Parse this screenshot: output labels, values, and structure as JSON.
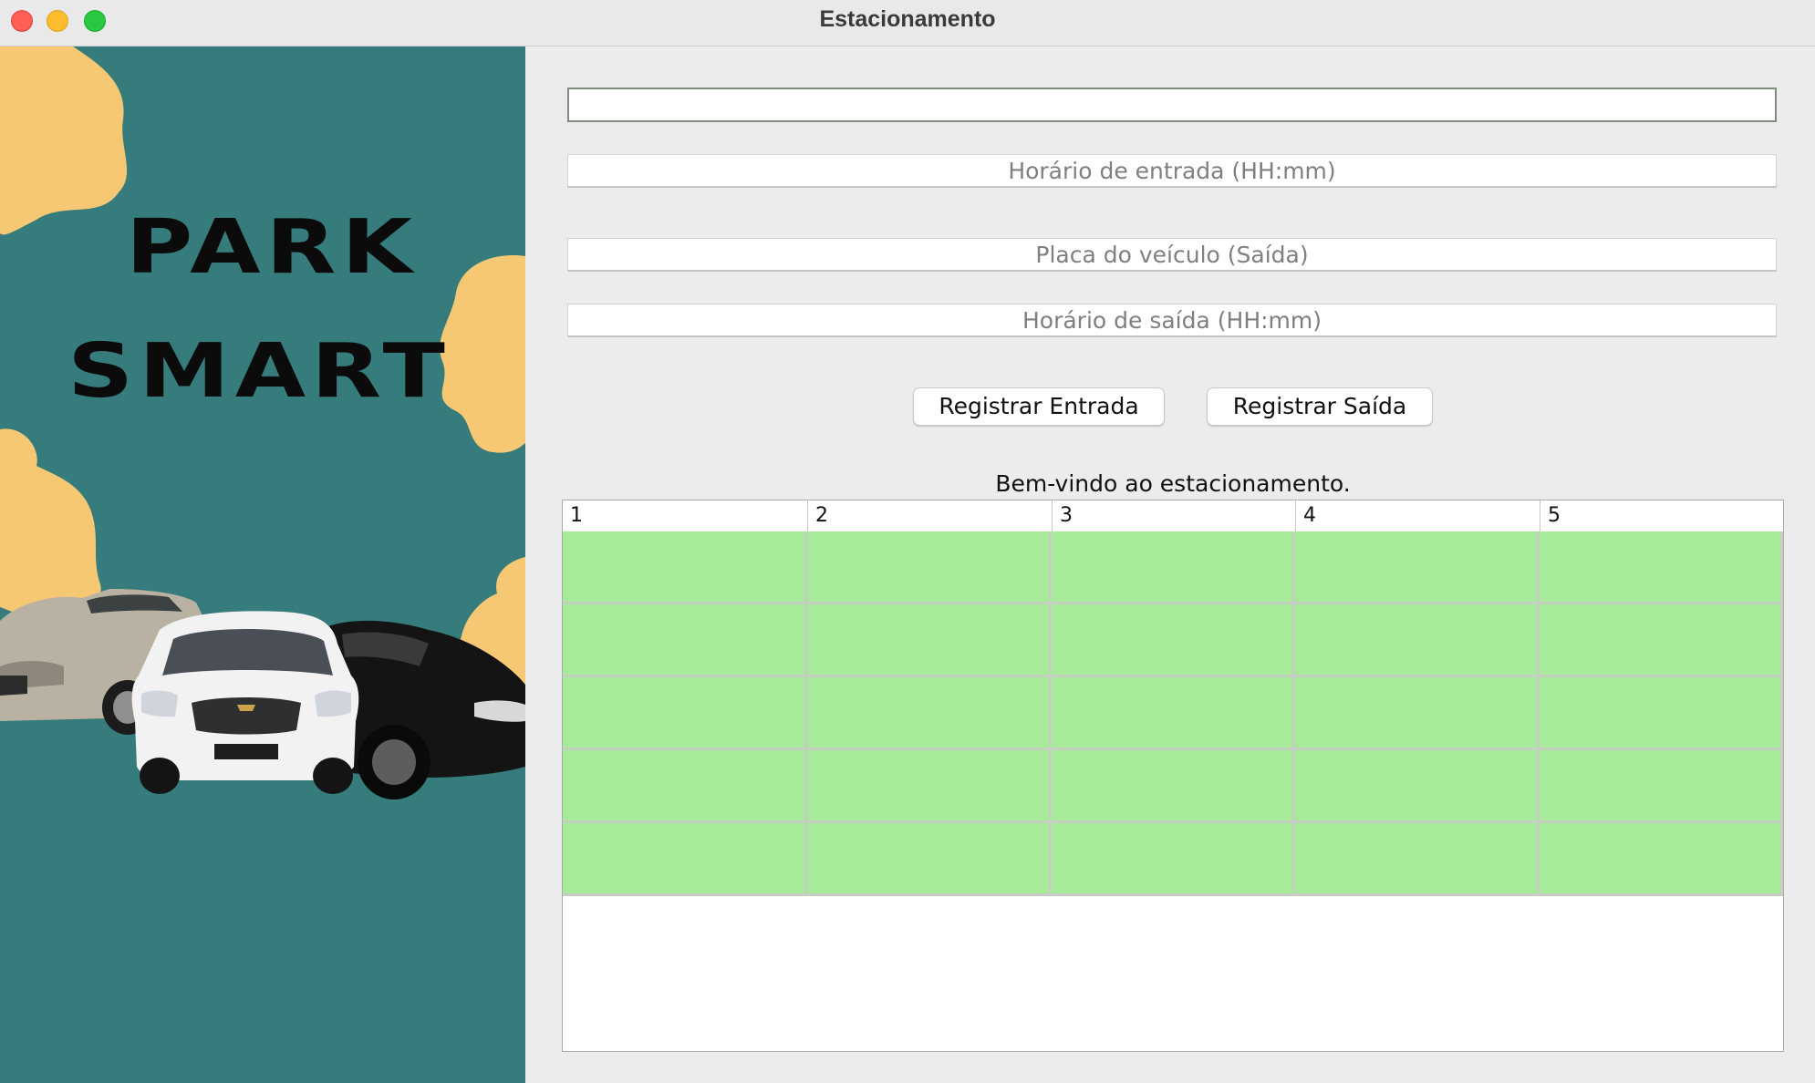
{
  "window": {
    "title": "Estacionamento"
  },
  "brand": {
    "line1": "PARK",
    "line2": "SMART",
    "panel_color": "#367c7c",
    "blob_color": "#f7c873"
  },
  "form": {
    "plate_entry": {
      "value": "",
      "placeholder": ""
    },
    "entry_time": {
      "value": "",
      "placeholder": "Horário de entrada (HH:mm)"
    },
    "plate_exit": {
      "value": "",
      "placeholder": "Placa do veículo (Saída)"
    },
    "exit_time": {
      "value": "",
      "placeholder": "Horário de saída (HH:mm)"
    }
  },
  "buttons": {
    "register_entry": "Registrar Entrada",
    "register_exit": "Registrar Saída"
  },
  "status_message": "Bem-vindo ao estacionamento.",
  "table": {
    "columns": [
      "1",
      "2",
      "3",
      "4",
      "5"
    ],
    "rows": [
      [
        "",
        "",
        "",
        "",
        ""
      ],
      [
        "",
        "",
        "",
        "",
        ""
      ],
      [
        "",
        "",
        "",
        "",
        ""
      ],
      [
        "",
        "",
        "",
        "",
        ""
      ],
      [
        "",
        "",
        "",
        "",
        ""
      ]
    ],
    "free_color": "#a7eb9a"
  }
}
